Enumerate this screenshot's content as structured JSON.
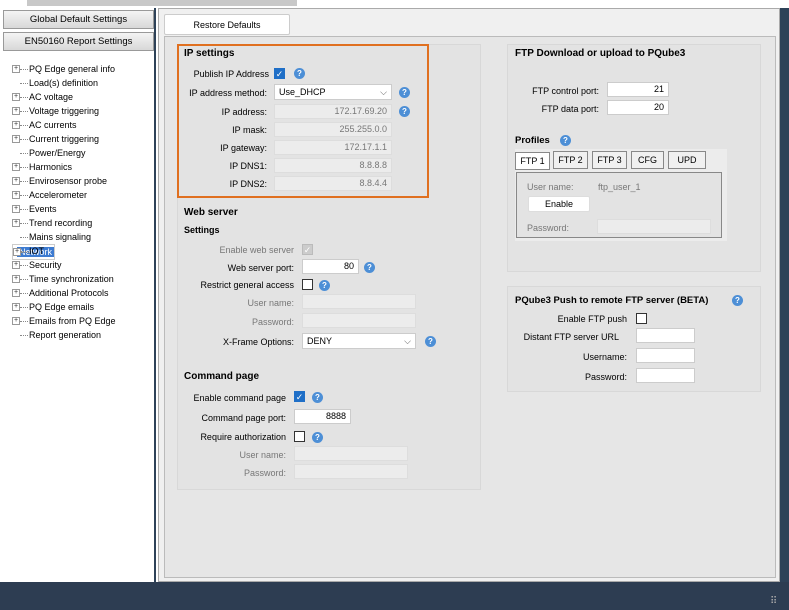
{
  "sidebar": {
    "buttons": [
      "Global Default Settings",
      "EN50160 Report Settings"
    ],
    "items": [
      {
        "label": "PQ Edge general info",
        "expand": true
      },
      {
        "label": "Load(s) definition",
        "expand": false
      },
      {
        "label": "AC voltage",
        "expand": true
      },
      {
        "label": "Voltage triggering",
        "expand": true
      },
      {
        "label": "AC currents",
        "expand": true
      },
      {
        "label": "Current triggering",
        "expand": true
      },
      {
        "label": "Power/Energy",
        "expand": false
      },
      {
        "label": "Harmonics",
        "expand": true
      },
      {
        "label": "Envirosensor probe",
        "expand": true
      },
      {
        "label": "Accelerometer",
        "expand": true
      },
      {
        "label": "Events",
        "expand": true
      },
      {
        "label": "Trend recording",
        "expand": true
      },
      {
        "label": "Mains signaling",
        "expand": false
      },
      {
        "label": "Network",
        "expand": true,
        "selected": true
      },
      {
        "label": "IOT",
        "expand": false
      },
      {
        "label": "Security",
        "expand": true
      },
      {
        "label": "Time synchronization",
        "expand": true
      },
      {
        "label": "Additional Protocols",
        "expand": true
      },
      {
        "label": "PQ Edge emails",
        "expand": true
      },
      {
        "label": "Emails from PQ Edge",
        "expand": true
      },
      {
        "label": "Report generation",
        "expand": false
      }
    ]
  },
  "toolbar": {
    "restore": "Restore Defaults"
  },
  "ip": {
    "title": "IP settings",
    "publish_label": "Publish IP Address",
    "method_label": "IP address method:",
    "method": "Use_DHCP",
    "address_label": "IP address:",
    "address": "172.17.69.20",
    "mask_label": "IP mask:",
    "mask": "255.255.0.0",
    "gateway_label": "IP gateway:",
    "gateway": "172.17.1.1",
    "dns1_label": "IP DNS1:",
    "dns1": "8.8.8.8",
    "dns2_label": "IP DNS2:",
    "dns2": "8.8.4.4",
    "highlight": "#e07020"
  },
  "web": {
    "title": "Web server",
    "settings": "Settings",
    "enable": "Enable web server",
    "port_label": "Web server port:",
    "port": "80",
    "restrict": "Restrict general access",
    "user": "User name:",
    "pass": "Password:",
    "xframe_label": "X-Frame Options:",
    "xframe": "DENY"
  },
  "cmd": {
    "title": "Command page",
    "enable": "Enable command page",
    "port_label": "Command page port:",
    "port": "8888",
    "auth": "Require authorization",
    "user": "User name:",
    "pass": "Password:"
  },
  "ftp": {
    "title": "FTP Download or upload to PQube3",
    "ctrl_label": "FTP control port:",
    "ctrl": "21",
    "data_label": "FTP data port:",
    "data": "20",
    "profiles": "Profiles",
    "tabs": [
      "FTP 1",
      "FTP 2",
      "FTP 3",
      "CFG",
      "UPD"
    ],
    "user_label": "User name:",
    "user": "ftp_user_1",
    "enable": "Enable",
    "pass_label": "Password:"
  },
  "push": {
    "title": "PQube3 Push to remote FTP server (BETA)",
    "enable": "Enable FTP push",
    "url": "Distant FTP server URL",
    "user": "Username:",
    "pass": "Password:"
  }
}
